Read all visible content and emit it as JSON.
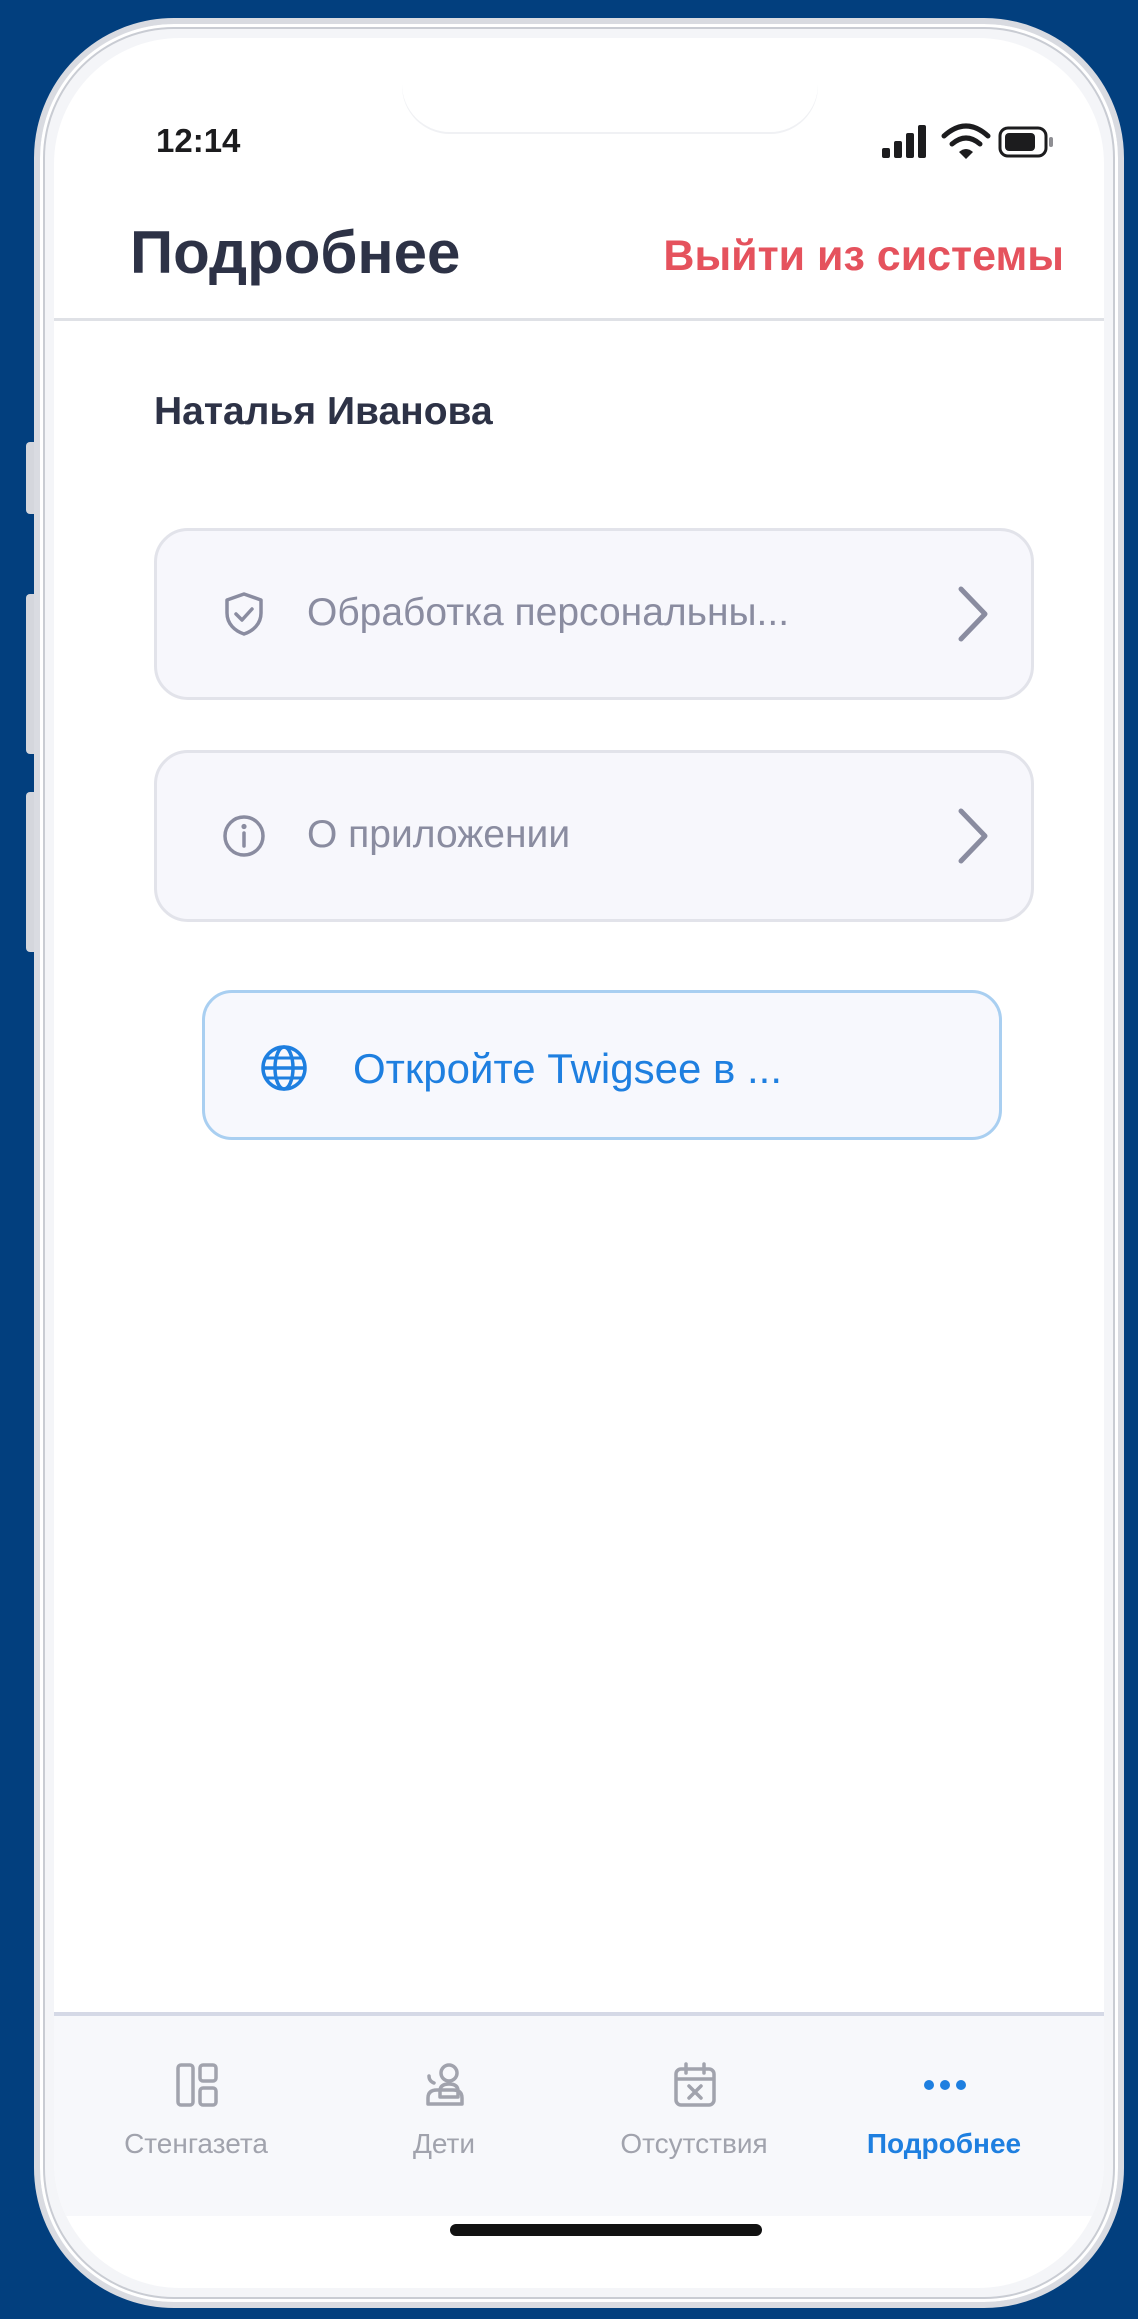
{
  "status_bar": {
    "time": "12:14",
    "icons": [
      "signal-icon",
      "wifi-icon",
      "battery-icon"
    ]
  },
  "header": {
    "title": "Подробнее",
    "logout_label": "Выйти из системы"
  },
  "user": {
    "name": "Наталья Иванова"
  },
  "menu": {
    "items": [
      {
        "icon": "shield-check-icon",
        "label": "Обработка персональны..."
      },
      {
        "icon": "info-icon",
        "label": "О приложении"
      }
    ],
    "open_web": {
      "icon": "globe-icon",
      "label": "Откройте Twigsee в ..."
    }
  },
  "tabbar": {
    "tabs": [
      {
        "icon": "dashboard-icon",
        "label": "Стенгазета",
        "active": false
      },
      {
        "icon": "children-icon",
        "label": "Дети",
        "active": false
      },
      {
        "icon": "calendar-x-icon",
        "label": "Отсутствия",
        "active": false
      },
      {
        "icon": "more-dots-icon",
        "label": "Подробнее",
        "active": true
      }
    ]
  },
  "colors": {
    "background": "#023f7e",
    "title_text": "#2d3246",
    "logout": "#e5525d",
    "accent": "#1e7fe0",
    "muted_text": "#8a8ca0",
    "tab_inactive": "#a1a3ad"
  }
}
